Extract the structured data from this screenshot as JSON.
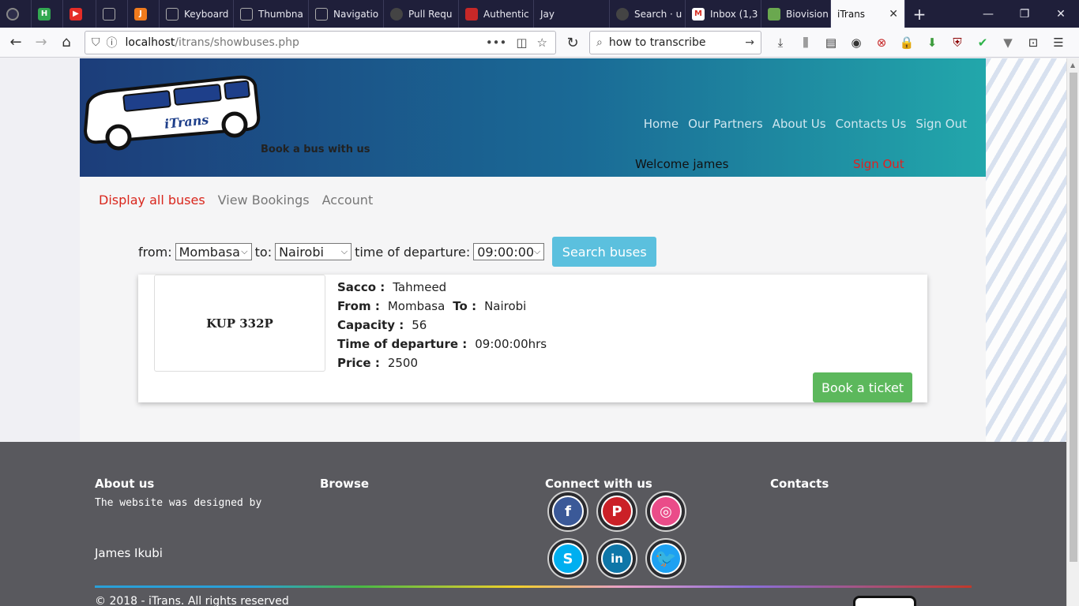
{
  "browser": {
    "tabs": [
      {
        "label": "",
        "color": "#2d2d4a",
        "icon": "circle-icon"
      },
      {
        "label": "",
        "color": "#33a852",
        "icon": "h-icon"
      },
      {
        "label": "",
        "color": "#e52d27",
        "icon": "youtube-icon"
      },
      {
        "label": "",
        "color": "#5a5a78",
        "icon": "screen-icon"
      },
      {
        "label": "",
        "color": "#f07b1d",
        "icon": "j-icon"
      },
      {
        "label": "Keyboard",
        "color": "#5a5a78",
        "icon": "screen-icon"
      },
      {
        "label": "Thumbna",
        "color": "#5a5a78",
        "icon": "screen-icon"
      },
      {
        "label": "Navigatio",
        "color": "#5a5a78",
        "icon": "screen-icon"
      },
      {
        "label": "Pull Requ",
        "color": "#222",
        "icon": "github-icon"
      },
      {
        "label": "Authentic",
        "color": "#c62828",
        "icon": "laravel-icon"
      },
      {
        "label": "Jay",
        "color": "#1f1f3a",
        "icon": "blank-icon"
      },
      {
        "label": "Search · u",
        "color": "#222",
        "icon": "github-icon"
      },
      {
        "label": "Inbox (1,3",
        "color": "#d93025",
        "icon": "gmail-icon"
      },
      {
        "label": "Biovision",
        "color": "#6aa84f",
        "icon": "leaf-icon"
      },
      {
        "label": "iTrans",
        "color": "#f9f9fb",
        "icon": "blank-icon"
      }
    ],
    "url_host": "localhost",
    "url_path": "/itrans/showbuses.php",
    "search_text": "how to transcribe"
  },
  "header": {
    "logo_text": "iTrans",
    "tagline": "Book a bus with us",
    "nav": [
      "Home",
      "Our Partners",
      "About Us",
      "Contacts Us",
      "Sign Out"
    ],
    "welcome": "Welcome james",
    "signout": "Sign Out"
  },
  "subnav": {
    "active": "Display all buses",
    "items": [
      "View Bookings",
      "Account"
    ]
  },
  "search": {
    "from_label": "from:",
    "from_value": "Mombasa",
    "to_label": "to:",
    "to_value": "Nairobi",
    "time_label": "time of departure:",
    "time_value": "09:00:00",
    "button": "Search buses"
  },
  "bus": {
    "plate": "KUP 332P",
    "sacco_label": "Sacco :",
    "sacco": "Tahmeed",
    "from_label": "From :",
    "from": "Mombasa",
    "to_label": "To :",
    "to": "Nairobi",
    "capacity_label": "Capacity :",
    "capacity": "56",
    "time_label": "Time of departure :",
    "time": "09:00:00hrs",
    "price_label": "Price :",
    "price": "2500",
    "book_button": "Book a ticket"
  },
  "footer": {
    "about_title": "About us",
    "about_text": "The website was designed by",
    "designer": "James Ikubi",
    "browse_title": "Browse",
    "connect_title": "Connect with us",
    "contacts_title": "Contacts",
    "socials": [
      {
        "name": "facebook-icon",
        "glyph": "f",
        "color": "#3b5998"
      },
      {
        "name": "pinterest-icon",
        "glyph": "P",
        "color": "#cb2027"
      },
      {
        "name": "dribbble-icon",
        "glyph": "◎",
        "color": "#ea4c89"
      },
      {
        "name": "skype-icon",
        "glyph": "S",
        "color": "#00aff0"
      },
      {
        "name": "linkedin-icon",
        "glyph": "in",
        "color": "#0e76a8"
      },
      {
        "name": "twitter-icon",
        "glyph": "t",
        "color": "#1da1f2"
      }
    ],
    "copyright": "© 2018 - iTrans. All rights reserved"
  }
}
